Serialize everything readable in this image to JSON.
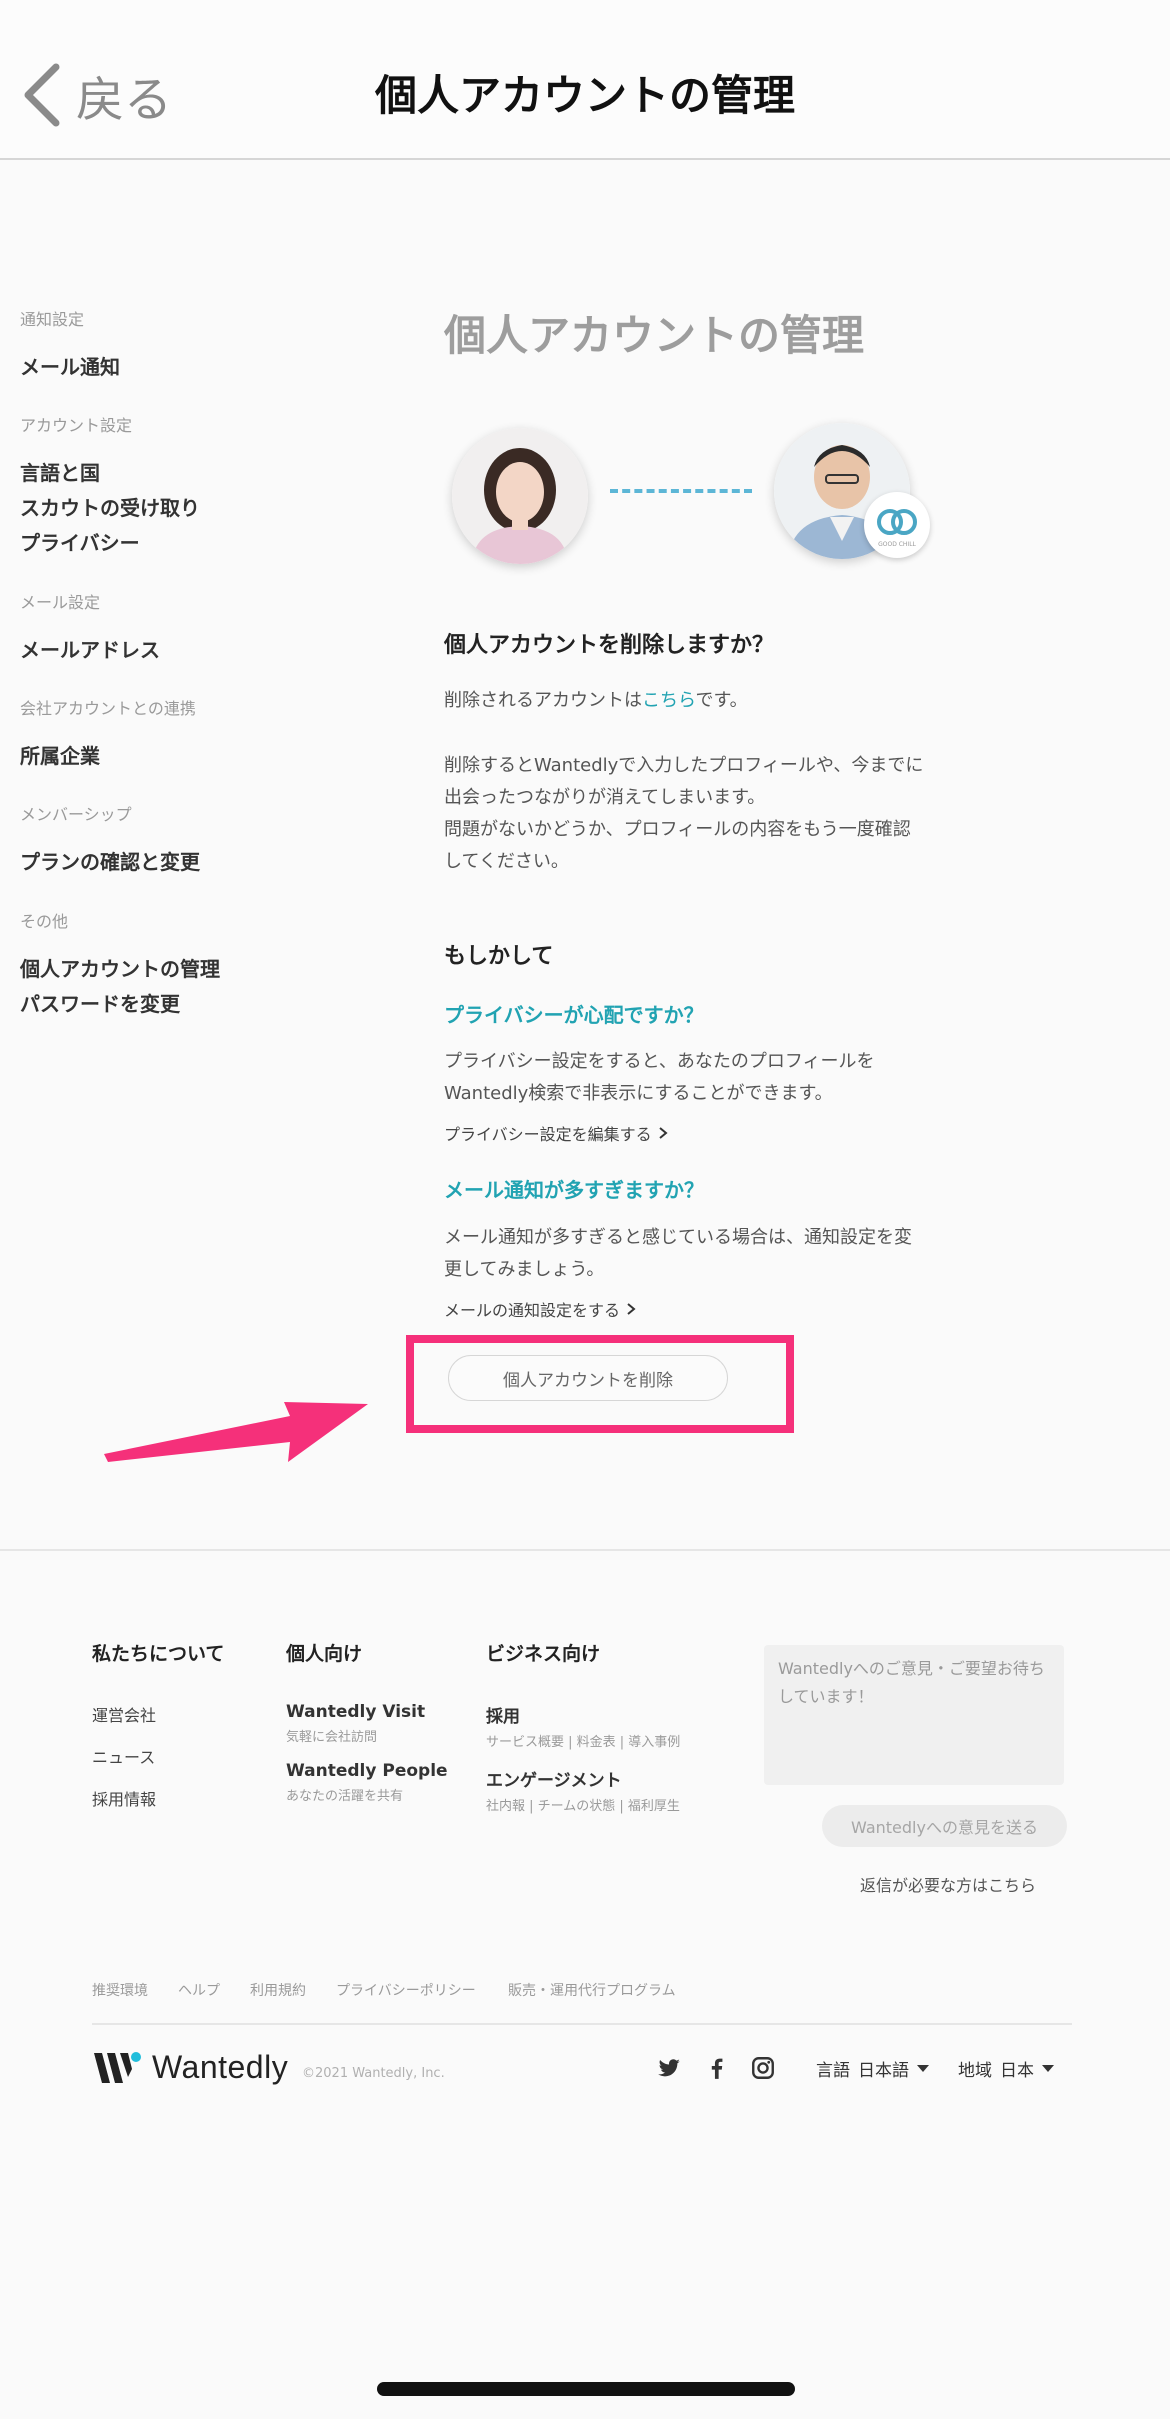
{
  "header": {
    "back_label": "戻る",
    "title": "個人アカウントの管理"
  },
  "sidebar": {
    "groups": [
      {
        "heading": "通知設定",
        "items": [
          "メール通知"
        ]
      },
      {
        "heading": "アカウント設定",
        "items": [
          "言語と国",
          "スカウトの受け取り",
          "プライバシー"
        ]
      },
      {
        "heading": "メール設定",
        "items": [
          "メールアドレス"
        ]
      },
      {
        "heading": "会社アカウントとの連携",
        "items": [
          "所属企業"
        ]
      },
      {
        "heading": "メンバーシップ",
        "items": [
          "プランの確認と変更"
        ]
      },
      {
        "heading": "その他",
        "items": [
          "個人アカウントの管理",
          "パスワードを変更"
        ]
      }
    ]
  },
  "main": {
    "title": "個人アカウントの管理",
    "badge_text": "GOOD CHILL",
    "question": "個人アカウントを削除しますか？",
    "account_text_pre": "削除されるアカウントは",
    "account_link": "こちら",
    "account_text_post": "です。",
    "warning_lines": [
      "削除するとWantedlyで入力したプロフィールや、今までに",
      "出会ったつながりが消えてしまいます。",
      "問題がないかどうか、プロフィールの内容をもう一度確認",
      "してください。"
    ],
    "maybe_heading": "もしかして",
    "privacy_heading": "プライバシーが心配ですか？",
    "privacy_lines": [
      "プライバシー設定をすると、あなたのプロフィールを",
      "Wantedly検索で非表示にすることができます。"
    ],
    "privacy_link": "プライバシー設定を編集する",
    "mail_heading": "メール通知が多すぎますか？",
    "mail_lines": [
      "メール通知が多すぎると感じている場合は、通知設定を変",
      "更してみましょう。"
    ],
    "mail_link": "メールの通知設定をする",
    "delete_button": "個人アカウントを削除"
  },
  "footer": {
    "about": {
      "heading": "私たちについて",
      "items": [
        "運営会社",
        "ニュース",
        "採用情報"
      ]
    },
    "personal": {
      "heading": "個人向け",
      "items": [
        {
          "title": "Wantedly Visit",
          "sub": "気軽に会社訪問"
        },
        {
          "title": "Wantedly People",
          "sub": "あなたの活躍を共有"
        }
      ]
    },
    "business": {
      "heading": "ビジネス向け",
      "items": [
        {
          "title": "採用",
          "sub": "サービス概要 | 料金表 | 導入事例"
        },
        {
          "title": "エンゲージメント",
          "sub": "社内報 | チームの状態 | 福利厚生"
        }
      ]
    },
    "feedback_placeholder": "Wantedlyへのご意見・ご要望お待ちしています！",
    "send_button": "Wantedlyへの意見を送る",
    "reply_link": "返信が必要な方はこちら",
    "legal_links": [
      "推奨環境",
      "ヘルプ",
      "利用規約",
      "プライバシーポリシー",
      "販売・運用代行プログラム"
    ],
    "brand": "Wantedly",
    "copyright": "©2021 Wantedly, Inc.",
    "language_label": "言語",
    "language_value": "日本語",
    "region_label": "地域",
    "region_value": "日本"
  },
  "colors": {
    "accent_teal": "#21a3b2",
    "highlight_pink": "#f5307a",
    "dashed_line": "#5cb6d6"
  },
  "icons": [
    "chevron-left-icon",
    "twitter-icon",
    "facebook-icon",
    "instagram-icon",
    "caret-down-icon",
    "arrow-annotation"
  ]
}
